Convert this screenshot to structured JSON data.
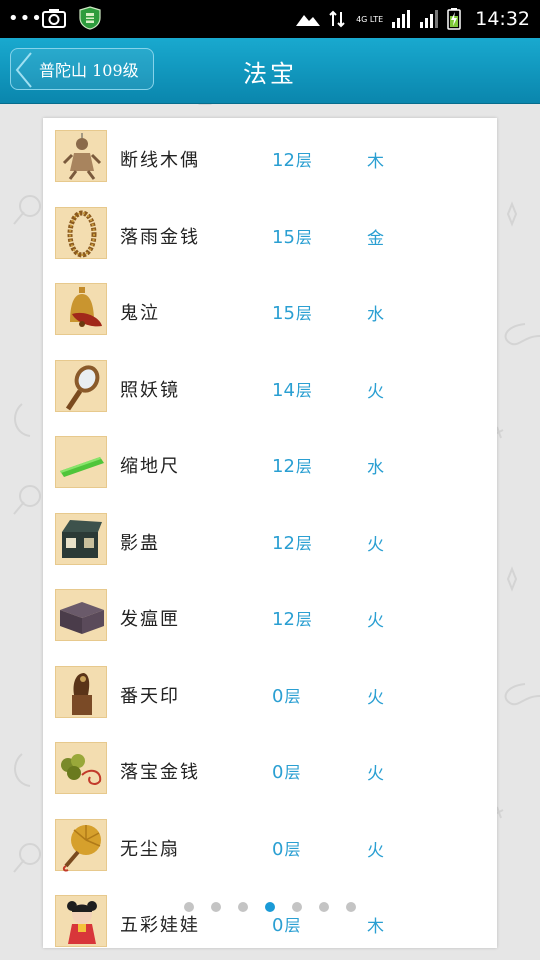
{
  "status_bar": {
    "time": "14:32",
    "network": "4G LTE"
  },
  "header": {
    "back_label": "普陀山 109级",
    "title": "法宝"
  },
  "items": [
    {
      "name": "断线木偶",
      "level": "12",
      "unit": "层",
      "element": "木",
      "icon": "puppet-icon"
    },
    {
      "name": "落雨金钱",
      "level": "15",
      "unit": "层",
      "element": "金",
      "icon": "coin-string-icon"
    },
    {
      "name": "鬼泣",
      "level": "15",
      "unit": "层",
      "element": "水",
      "icon": "bell-icon"
    },
    {
      "name": "照妖镜",
      "level": "14",
      "unit": "层",
      "element": "火",
      "icon": "mirror-icon"
    },
    {
      "name": "缩地尺",
      "level": "12",
      "unit": "层",
      "element": "水",
      "icon": "ruler-icon"
    },
    {
      "name": "影蛊",
      "level": "12",
      "unit": "层",
      "element": "火",
      "icon": "box-icon"
    },
    {
      "name": "发瘟匣",
      "level": "12",
      "unit": "层",
      "element": "火",
      "icon": "chest-icon"
    },
    {
      "name": "番天印",
      "level": "0",
      "unit": "层",
      "element": "火",
      "icon": "seal-icon"
    },
    {
      "name": "落宝金钱",
      "level": "0",
      "unit": "层",
      "element": "火",
      "icon": "coins-icon"
    },
    {
      "name": "无尘扇",
      "level": "0",
      "unit": "层",
      "element": "火",
      "icon": "fan-icon"
    },
    {
      "name": "五彩娃娃",
      "level": "0",
      "unit": "层",
      "element": "木",
      "icon": "doll-icon"
    }
  ],
  "pager": {
    "count": 7,
    "active_index": 3
  },
  "colors": {
    "header": "#0f97c0",
    "accent": "#2a9fd2",
    "thumb_bg": "#f3ddb0"
  }
}
